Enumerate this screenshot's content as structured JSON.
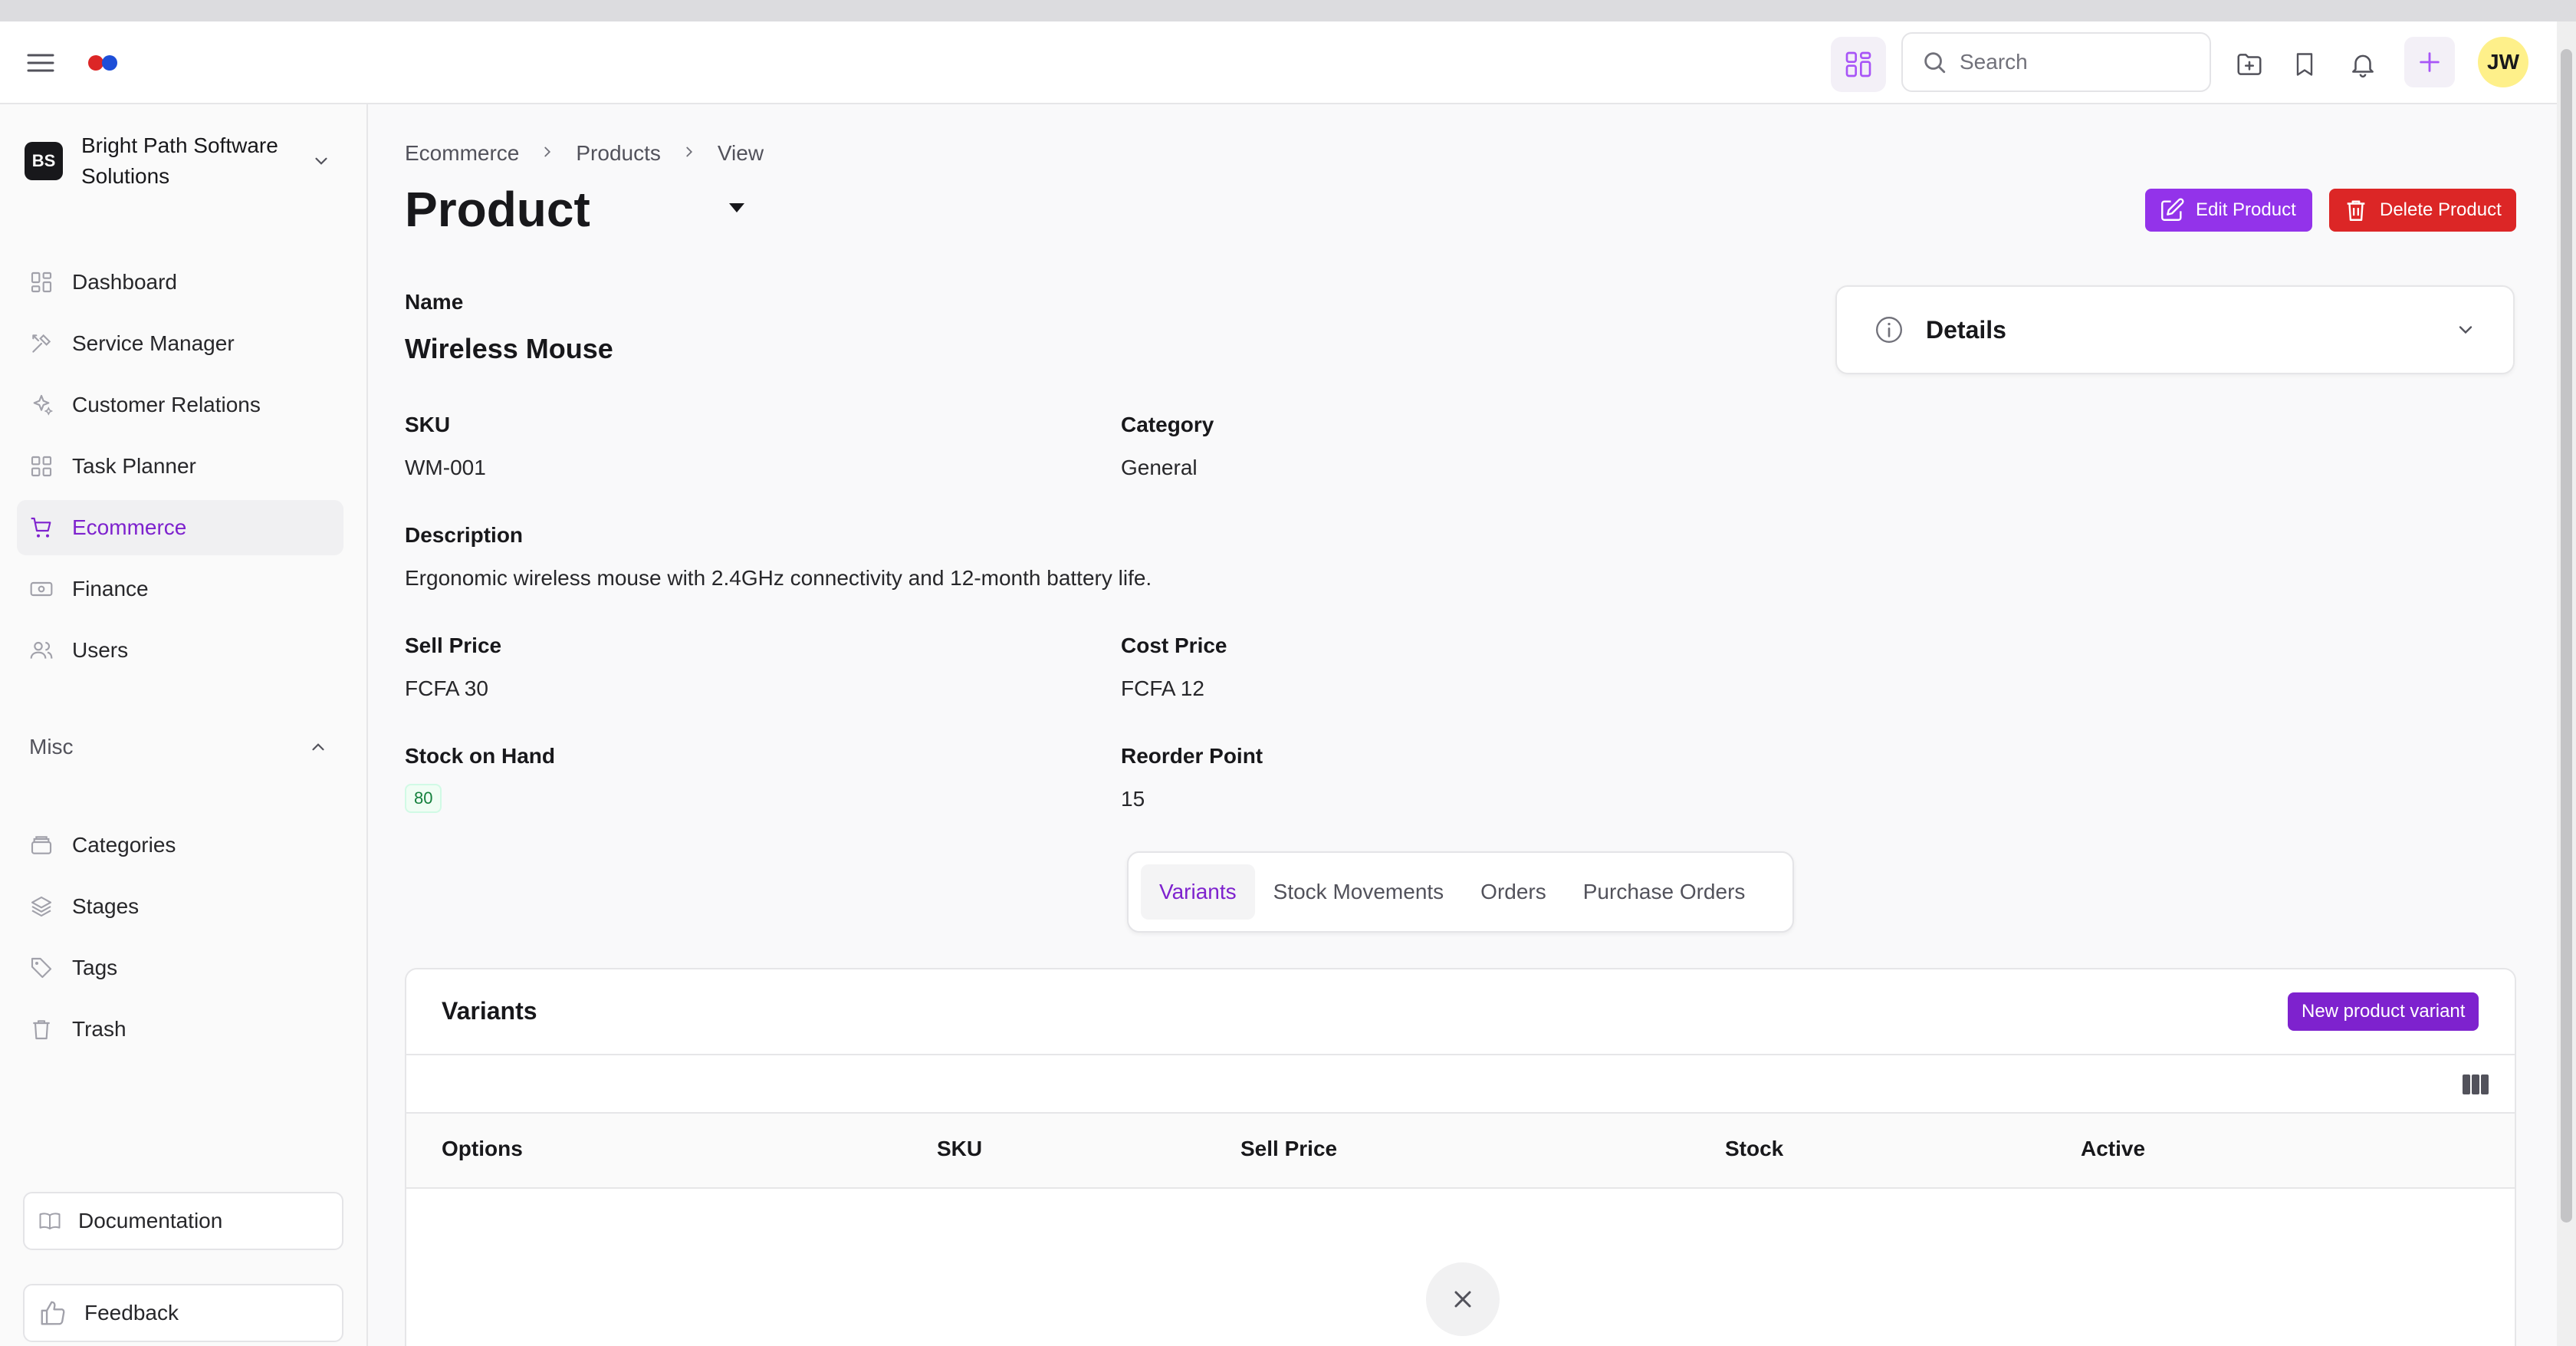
{
  "topbar": {
    "search_placeholder": "Search",
    "user_initials": "JW"
  },
  "sidebar": {
    "org": {
      "initials": "BS",
      "name": "Bright Path Software Solutions"
    },
    "items": [
      {
        "label": "Dashboard",
        "icon": "dashboard-icon"
      },
      {
        "label": "Service Manager",
        "icon": "tools-icon"
      },
      {
        "label": "Customer Relations",
        "icon": "sparkles-icon"
      },
      {
        "label": "Task Planner",
        "icon": "grid-icon"
      },
      {
        "label": "Ecommerce",
        "icon": "cart-icon",
        "active": true
      },
      {
        "label": "Finance",
        "icon": "banknote-icon"
      },
      {
        "label": "Users",
        "icon": "users-icon"
      }
    ],
    "misc_label": "Misc",
    "misc_items": [
      {
        "label": "Categories",
        "icon": "archive-icon"
      },
      {
        "label": "Stages",
        "icon": "layers-icon"
      },
      {
        "label": "Tags",
        "icon": "tag-icon"
      },
      {
        "label": "Trash",
        "icon": "trash-icon"
      }
    ],
    "documentation_label": "Documentation",
    "feedback_label": "Feedback"
  },
  "breadcrumb": [
    "Ecommerce",
    "Products",
    "View"
  ],
  "page_title": "Product",
  "actions": {
    "edit": "Edit Product",
    "delete": "Delete Product"
  },
  "product": {
    "name_label": "Name",
    "name": "Wireless Mouse",
    "sku_label": "SKU",
    "sku": "WM-001",
    "category_label": "Category",
    "category": "General",
    "description_label": "Description",
    "description": "Ergonomic wireless mouse with 2.4GHz connectivity and 12-month battery life.",
    "sell_price_label": "Sell Price",
    "sell_price": "FCFA 30",
    "cost_price_label": "Cost Price",
    "cost_price": "FCFA 12",
    "stock_label": "Stock on Hand",
    "stock": "80",
    "reorder_label": "Reorder Point",
    "reorder": "15"
  },
  "details_card": {
    "title": "Details"
  },
  "tabs": [
    "Variants",
    "Stock Movements",
    "Orders",
    "Purchase Orders"
  ],
  "variants": {
    "title": "Variants",
    "new_button": "New product variant",
    "columns": [
      "Options",
      "SKU",
      "Sell Price",
      "Stock",
      "Active"
    ]
  },
  "colors": {
    "accent": "#7e22ce",
    "danger": "#dc2626",
    "avatar_bg": "#fef08a"
  }
}
